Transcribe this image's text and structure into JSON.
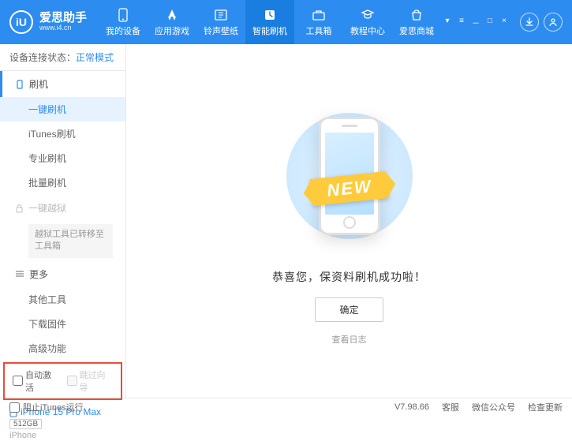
{
  "header": {
    "logo_text": "爱思助手",
    "logo_sub": "www.i4.cn",
    "logo_letter": "iU",
    "nav": [
      {
        "label": "我的设备"
      },
      {
        "label": "应用游戏"
      },
      {
        "label": "铃声壁纸"
      },
      {
        "label": "智能刷机"
      },
      {
        "label": "工具箱"
      },
      {
        "label": "教程中心"
      },
      {
        "label": "爱思商城"
      }
    ]
  },
  "sidebar": {
    "conn_label": "设备连接状态：",
    "conn_mode": "正常模式",
    "section_flash": "刷机",
    "items_flash": [
      {
        "label": "一键刷机",
        "active": true
      },
      {
        "label": "iTunes刷机"
      },
      {
        "label": "专业刷机"
      },
      {
        "label": "批量刷机"
      }
    ],
    "section_jailbreak": "一键越狱",
    "jailbreak_note": "越狱工具已转移至工具箱",
    "section_more": "更多",
    "items_more": [
      {
        "label": "其他工具"
      },
      {
        "label": "下载固件"
      },
      {
        "label": "高级功能"
      }
    ],
    "cb_auto_activate": "自动激活",
    "cb_skip_guide": "跳过向导",
    "device": {
      "name": "iPhone 15 Pro Max",
      "storage": "512GB",
      "type": "iPhone"
    }
  },
  "main": {
    "banner_text": "NEW",
    "success_text": "恭喜您，保资料刷机成功啦！",
    "ok_button": "确定",
    "view_log": "查看日志"
  },
  "footer": {
    "block_itunes": "阻止iTunes运行",
    "version": "V7.98.66",
    "links": [
      "客服",
      "微信公众号",
      "检查更新"
    ]
  }
}
